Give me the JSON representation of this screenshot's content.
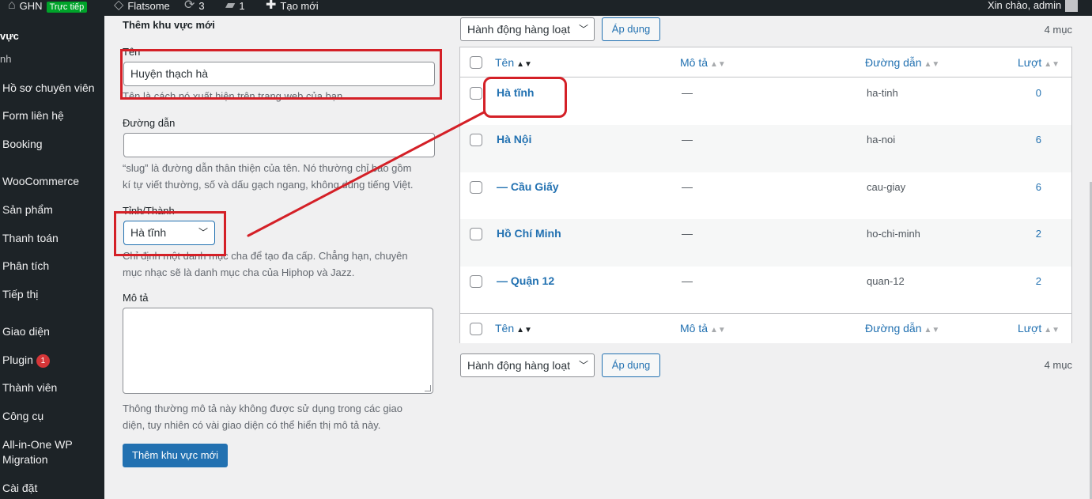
{
  "adminbar": {
    "site_name": "GHN",
    "live_badge": "Trực tiếp",
    "theme_name": "Flatsome",
    "updates_count": "3",
    "comments_count": "1",
    "new_label": "Tạo mới",
    "greeting": "Xin chào, admin"
  },
  "sidebar": {
    "sub_current": "vực",
    "sub_item": "nh",
    "items": [
      "Hồ sơ chuyên viên",
      "Form liên hệ",
      "Booking",
      "WooCommerce",
      "Sản phẩm",
      "Thanh toán",
      "Phân tích",
      "Tiếp thị",
      "Giao diện",
      "Plugin",
      "Thành viên",
      "Công cụ",
      "All-in-One WP",
      "Migration",
      "Cài đặt"
    ],
    "plugin_badge": "1"
  },
  "form": {
    "title": "Thêm khu vực mới",
    "name_label": "Tên",
    "name_value": "Huyện thạch hà",
    "name_help": "Tên là cách nó xuất hiện trên trang web của bạn.",
    "slug_label": "Đường dẫn",
    "slug_value": "",
    "slug_help_1": "“slug” là đường dẫn thân thiện của tên. Nó thường chỉ bao gồm",
    "slug_help_2": "kí tự viết thường, số và dấu gạch ngang, không dùng tiếng Việt.",
    "parent_label": "Tỉnh/Thành",
    "parent_value": "Hà tĩnh",
    "parent_help_1": "Chỉ định một danh mục cha để tạo đa cấp. Chẳng hạn, chuyên",
    "parent_help_2": "mục nhạc sẽ là danh mục cha của Hiphop và Jazz.",
    "desc_label": "Mô tả",
    "desc_help_1": "Thông thường mô tả này không được sử dụng trong các giao",
    "desc_help_2": "diện, tuy nhiên có vài giao diện có thể hiển thị mô tả này.",
    "submit_label": "Thêm khu vực mới"
  },
  "bulk": {
    "action_label": "Hành động hàng loạt",
    "apply_label": "Áp dụng",
    "count_label": "4 mục"
  },
  "table": {
    "columns": [
      "Tên",
      "Mô tả",
      "Đường dẫn",
      "Lượt"
    ],
    "rows": [
      {
        "name": "Hà tĩnh",
        "desc": "—",
        "slug": "ha-tinh",
        "count": "0"
      },
      {
        "name": "Hà Nội",
        "desc": "—",
        "slug": "ha-noi",
        "count": "6"
      },
      {
        "name": "— Cầu Giấy",
        "desc": "—",
        "slug": "cau-giay",
        "count": "6"
      },
      {
        "name": "Hồ Chí Minh",
        "desc": "—",
        "slug": "ho-chi-minh",
        "count": "2"
      },
      {
        "name": "— Quận 12",
        "desc": "—",
        "slug": "quan-12",
        "count": "2"
      }
    ]
  },
  "colors": {
    "accent": "#2271b1",
    "sidebar_bg": "#1d2327",
    "annotation_red": "#d42027"
  }
}
